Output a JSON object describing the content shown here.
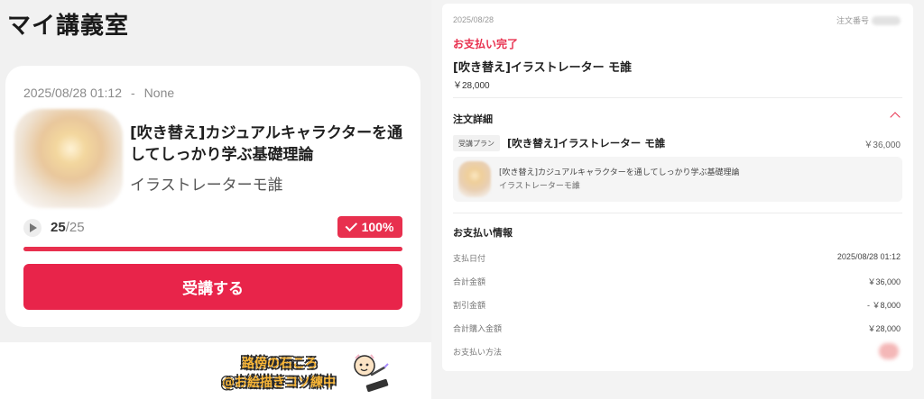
{
  "left": {
    "page_title": "マイ講義室",
    "card": {
      "datetime": "2025/08/28 01:12",
      "separator": "-",
      "expiry": "None",
      "course_title": "[吹き替え]カジュアルキャラクターを通してしっかり学ぶ基礎理論",
      "teacher": "イラストレーターモ誰",
      "lessons_done": "25",
      "lessons_total": "/25",
      "progress_percent": "100%",
      "progress_value": 1.0,
      "start_button_label": "受講する"
    },
    "watermark": {
      "line1": "路傍の石ころ",
      "line2": "@お絵描きコソ練中"
    }
  },
  "right": {
    "order_date": "2025/08/28",
    "order_number_label": "注文番号",
    "paid_status": "お支払い完了",
    "product_name": "[吹き替え]イラストレーター モ誰",
    "product_price": "￥28,000",
    "details_title": "注文詳細",
    "plan_tag": "受講プラン",
    "plan_name": "[吹き替え]イラストレーター モ誰",
    "plan_price": "￥36,000",
    "item_title": "[吹き替え]カジュアルキャラクターを通してしっかり学ぶ基礎理論",
    "item_teacher": "イラストレーターモ誰",
    "payment_info_title": "お支払い情報",
    "rows": [
      {
        "label": "支払日付",
        "value": "2025/08/28 01:12"
      },
      {
        "label": "合計金額",
        "value": "￥36,000"
      },
      {
        "label": "割引金額",
        "value": "- ￥8,000"
      },
      {
        "label": "合計購入金額",
        "value": "￥28,000"
      },
      {
        "label": "お支払い方法",
        "value": ""
      }
    ]
  },
  "colors": {
    "accent": "#e8304e",
    "panel_bg": "#f1f1f1"
  }
}
